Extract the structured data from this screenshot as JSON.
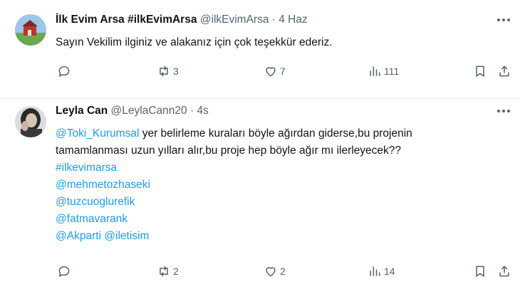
{
  "tweets": [
    {
      "name": "İlk Evim Arsa #ilkEvimArsa",
      "handle": "@ilkEvimArsa",
      "time": "4 Haz",
      "lines": [
        "Sayın Vekilim ilginiz ve alakanız için çok teşekkür ederiz."
      ],
      "retweets": "3",
      "likes": "7",
      "views": "111"
    },
    {
      "name": "Leyla Can",
      "handle": "@LeylaCann20",
      "time": "4s",
      "mention": "@Toki_Kurumsal",
      "line1_rest": " yer belirleme kuraları böyle ağırdan giderse,bu projenin",
      "line2": "tamamlanması uzun yılları alır,bu proje hep böyle ağır mı ilerleyecek??",
      "tags": [
        "#ilkevimarsa",
        "@mehmetozhaseki",
        "@tuzcuoglurefik",
        "@fatmavarank",
        "@Akparti",
        "@iletisim"
      ],
      "retweets": "2",
      "likes": "2",
      "views": "14"
    }
  ],
  "icons": [
    "reply-icon",
    "retweet-icon",
    "like-icon",
    "views-icon",
    "bookmark-icon",
    "share-icon",
    "more-icon"
  ],
  "colors": {
    "link": "#1d9bf0",
    "muted": "#536471",
    "text": "#0f1419"
  }
}
